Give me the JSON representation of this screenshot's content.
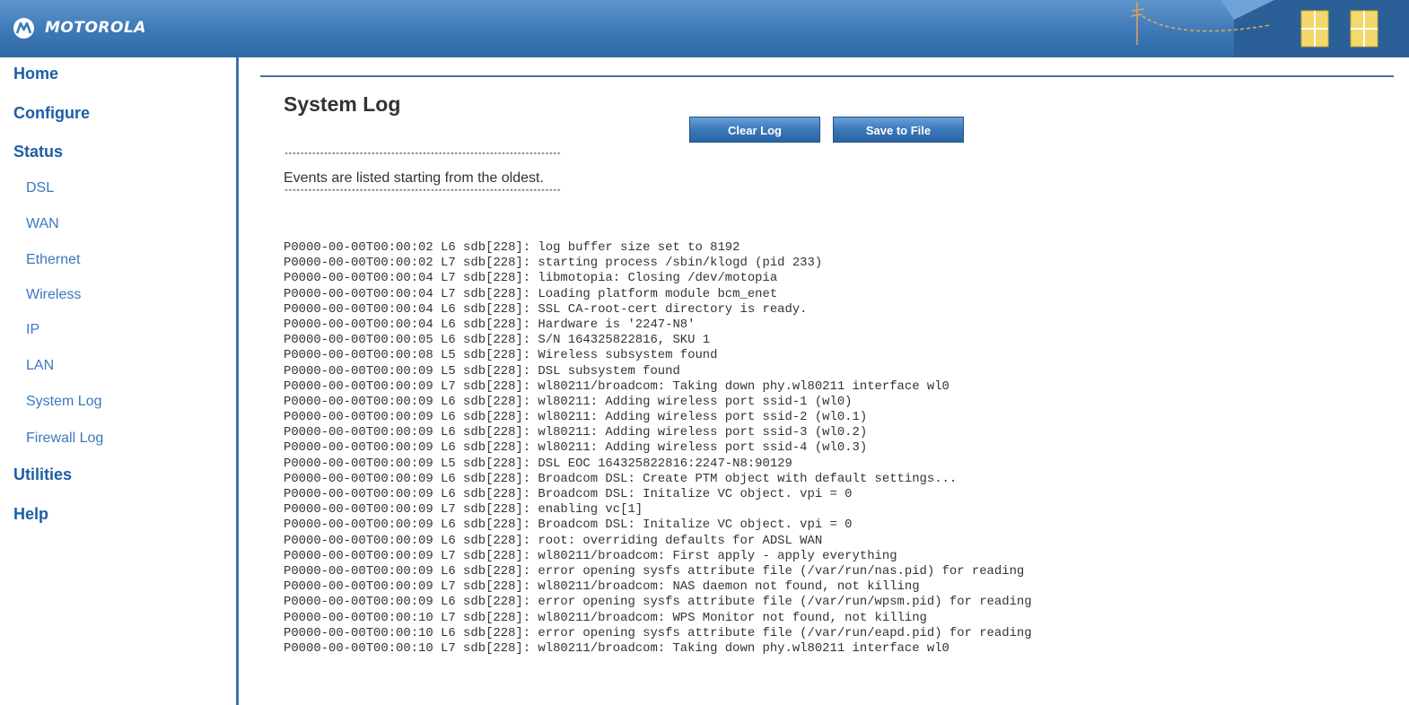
{
  "header": {
    "brand": "MOTOROLA",
    "brand_color": "#3d79b6",
    "logo_icon": "motorola-batwing-icon",
    "decoration": "house-window-illustration"
  },
  "sidebar": {
    "top_items": [
      {
        "label": "Home"
      },
      {
        "label": "Configure"
      },
      {
        "label": "Status"
      },
      {
        "label": "Utilities"
      },
      {
        "label": "Help"
      }
    ],
    "status_items": [
      {
        "label": "DSL"
      },
      {
        "label": "WAN"
      },
      {
        "label": "Ethernet"
      },
      {
        "label": "Wireless"
      },
      {
        "label": "IP"
      },
      {
        "label": "LAN"
      },
      {
        "label": "System Log"
      },
      {
        "label": "Firewall Log"
      }
    ]
  },
  "main": {
    "title": "System Log",
    "clear_log_label": "Clear Log",
    "save_to_file_label": "Save to File",
    "separator": "**********************************************************************",
    "events_note": "Events are listed starting from the oldest.",
    "log_lines": [
      "P0000-00-00T00:00:02 L6 sdb[228]: log buffer size set to 8192",
      "P0000-00-00T00:00:02 L7 sdb[228]: starting process /sbin/klogd (pid 233)",
      "P0000-00-00T00:00:04 L7 sdb[228]: libmotopia: Closing /dev/motopia",
      "P0000-00-00T00:00:04 L7 sdb[228]: Loading platform module bcm_enet",
      "P0000-00-00T00:00:04 L6 sdb[228]: SSL CA-root-cert directory is ready.",
      "P0000-00-00T00:00:04 L6 sdb[228]: Hardware is '2247-N8'",
      "P0000-00-00T00:00:05 L6 sdb[228]: S/N 164325822816, SKU 1",
      "P0000-00-00T00:00:08 L5 sdb[228]: Wireless subsystem found",
      "P0000-00-00T00:00:09 L5 sdb[228]: DSL subsystem found",
      "P0000-00-00T00:00:09 L7 sdb[228]: wl80211/broadcom: Taking down phy.wl80211 interface wl0",
      "P0000-00-00T00:00:09 L6 sdb[228]: wl80211: Adding wireless port ssid-1 (wl0)",
      "P0000-00-00T00:00:09 L6 sdb[228]: wl80211: Adding wireless port ssid-2 (wl0.1)",
      "P0000-00-00T00:00:09 L6 sdb[228]: wl80211: Adding wireless port ssid-3 (wl0.2)",
      "P0000-00-00T00:00:09 L6 sdb[228]: wl80211: Adding wireless port ssid-4 (wl0.3)",
      "P0000-00-00T00:00:09 L5 sdb[228]: DSL EOC 164325822816:2247-N8:90129",
      "P0000-00-00T00:00:09 L6 sdb[228]: Broadcom DSL: Create PTM object with default settings...",
      "P0000-00-00T00:00:09 L6 sdb[228]: Broadcom DSL: Initalize VC object. vpi = 0",
      "P0000-00-00T00:00:09 L7 sdb[228]: enabling vc[1]",
      "P0000-00-00T00:00:09 L6 sdb[228]: Broadcom DSL: Initalize VC object. vpi = 0",
      "P0000-00-00T00:00:09 L6 sdb[228]: root: overriding defaults for ADSL WAN",
      "P0000-00-00T00:00:09 L7 sdb[228]: wl80211/broadcom: First apply - apply everything",
      "P0000-00-00T00:00:09 L6 sdb[228]: error opening sysfs attribute file (/var/run/nas.pid) for reading",
      "P0000-00-00T00:00:09 L7 sdb[228]: wl80211/broadcom: NAS daemon not found, not killing",
      "P0000-00-00T00:00:09 L6 sdb[228]: error opening sysfs attribute file (/var/run/wpsm.pid) for reading",
      "P0000-00-00T00:00:10 L7 sdb[228]: wl80211/broadcom: WPS Monitor not found, not killing",
      "P0000-00-00T00:00:10 L6 sdb[228]: error opening sysfs attribute file (/var/run/eapd.pid) for reading",
      "P0000-00-00T00:00:10 L7 sdb[228]: wl80211/broadcom: Taking down phy.wl80211 interface wl0"
    ]
  }
}
